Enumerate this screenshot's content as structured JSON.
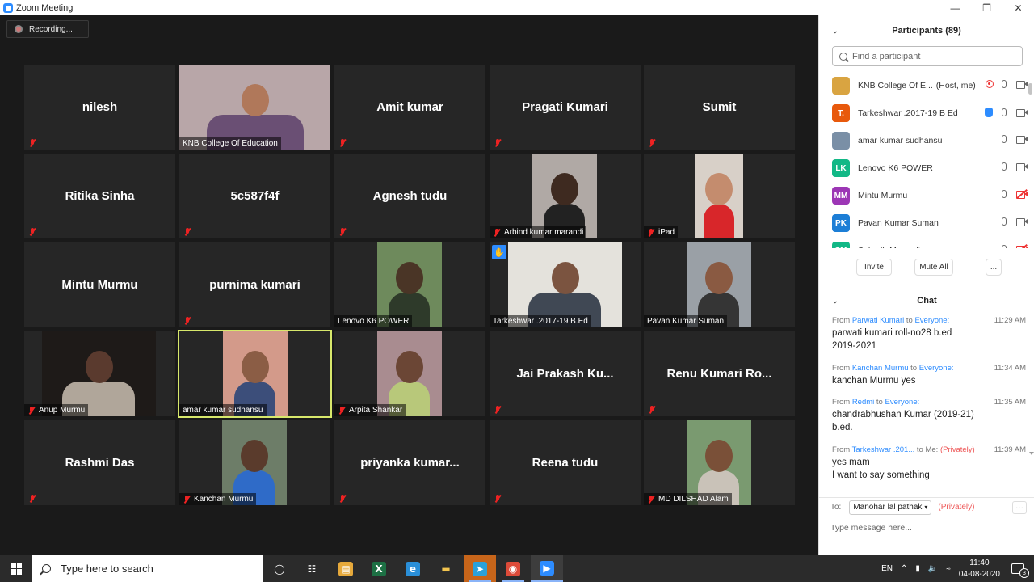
{
  "window": {
    "title": "Zoom Meeting",
    "controls": [
      "—",
      "❐",
      "✕"
    ]
  },
  "recording": {
    "label": "Recording..."
  },
  "tiles": [
    {
      "name": "nilesh",
      "video": false,
      "muted": true
    },
    {
      "name": "KNB College Of Education",
      "video": true,
      "muted": false
    },
    {
      "name": "Amit kumar",
      "video": false,
      "muted": true
    },
    {
      "name": "Pragati Kumari",
      "video": false,
      "muted": true
    },
    {
      "name": "Sumit",
      "video": false,
      "muted": true
    },
    {
      "name": "Ritika Sinha",
      "video": false,
      "muted": true
    },
    {
      "name": "5c587f4f",
      "video": false,
      "muted": true
    },
    {
      "name": "Agnesh tudu",
      "video": false,
      "muted": true
    },
    {
      "name": "Arbind kumar marandi",
      "video": true,
      "muted": true
    },
    {
      "name": "iPad",
      "video": true,
      "muted": true
    },
    {
      "name": "Mintu Murmu",
      "video": false,
      "muted": false
    },
    {
      "name": "purnima kumari",
      "video": false,
      "muted": true
    },
    {
      "name": "Lenovo K6 POWER",
      "video": true,
      "muted": false
    },
    {
      "name": "Tarkeshwar .2017-19 B.Ed",
      "video": true,
      "muted": false,
      "hand": true
    },
    {
      "name": "Pavan Kumar Suman",
      "video": true,
      "muted": false
    },
    {
      "name": "Anup Murmu",
      "video": true,
      "muted": true
    },
    {
      "name": "amar kumar sudhansu",
      "video": true,
      "muted": false,
      "active": true
    },
    {
      "name": "Arpita Shankar",
      "video": true,
      "muted": true
    },
    {
      "name": "Jai Prakash Ku...",
      "video": false,
      "muted": true
    },
    {
      "name": "Renu Kumari Ro...",
      "video": false,
      "muted": true
    },
    {
      "name": "Rashmi Das",
      "video": false,
      "muted": true
    },
    {
      "name": "Kanchan Murmu",
      "video": true,
      "muted": true
    },
    {
      "name": "priyanka kumar...",
      "video": false,
      "muted": true
    },
    {
      "name": "Reena tudu",
      "video": false,
      "muted": true
    },
    {
      "name": "MD DILSHAD Alam",
      "video": true,
      "muted": true
    }
  ],
  "participants": {
    "header": "Participants (89)",
    "search_placeholder": "Find a participant",
    "list": [
      {
        "initials": "",
        "name": "KNB College Of E...",
        "host": "(Host, me)",
        "avatar_color": "#d9a441",
        "recording": true,
        "hand": false,
        "cam_off": false
      },
      {
        "initials": "T.",
        "name": "Tarkeshwar .2017-19 B Ed",
        "host": "",
        "avatar_color": "#e8590c",
        "recording": false,
        "hand": true,
        "cam_off": false
      },
      {
        "initials": "",
        "name": "amar kumar sudhansu",
        "host": "",
        "avatar_color": "#7a8fa6",
        "recording": false,
        "hand": false,
        "cam_off": false
      },
      {
        "initials": "LK",
        "name": "Lenovo K6 POWER",
        "host": "",
        "avatar_color": "#12b886",
        "recording": false,
        "hand": false,
        "cam_off": false
      },
      {
        "initials": "MM",
        "name": "Mintu Murmu",
        "host": "",
        "avatar_color": "#9c36b5",
        "recording": false,
        "hand": false,
        "cam_off": true
      },
      {
        "initials": "PK",
        "name": "Pavan Kumar Suman",
        "host": "",
        "avatar_color": "#1c7ed6",
        "recording": false,
        "hand": false,
        "cam_off": false
      },
      {
        "initials": "SM",
        "name": "Subodh Marandi",
        "host": "",
        "avatar_color": "#12b886",
        "recording": false,
        "hand": false,
        "cam_off": true
      }
    ],
    "invite_label": "Invite",
    "mute_all_label": "Mute All",
    "more_label": "..."
  },
  "chat": {
    "header": "Chat",
    "messages": [
      {
        "from_word": "From",
        "sender": "Parwati Kumari",
        "to_word": "to",
        "recipient": "Everyone:",
        "private": "",
        "time": "11:29 AM",
        "lines": [
          "parwati kumari roll-no28 b.ed",
          "2019-2021"
        ]
      },
      {
        "from_word": "From",
        "sender": "Kanchan Murmu",
        "to_word": "to",
        "recipient": "Everyone:",
        "private": "",
        "time": "11:34 AM",
        "lines": [
          "kanchan Murmu yes"
        ]
      },
      {
        "from_word": "From",
        "sender": "Redmi",
        "to_word": "to",
        "recipient": "Everyone:",
        "private": "",
        "time": "11:35 AM",
        "lines": [
          "chandrabhushan Kumar (2019-21)",
          "b.ed."
        ]
      },
      {
        "from_word": "From",
        "sender": "Tarkeshwar .201...",
        "to_word": "to Me:",
        "recipient": "",
        "private": "(Privately)",
        "time": "11:39 AM",
        "lines": [
          "yes mam",
          "I want to say something"
        ]
      }
    ],
    "to_label": "To:",
    "to_value": "Manohar lal pathak",
    "to_private": "(Privately)",
    "more_label": "···",
    "input_placeholder": "Type message here..."
  },
  "taskbar": {
    "search_placeholder": "Type here to search",
    "apps": [
      "cortana-icon",
      "task-view-icon",
      "store-icon",
      "excel-icon",
      "edge-icon",
      "file-explorer-icon",
      "telegram-icon",
      "chrome-icon",
      "zoom-icon"
    ],
    "language": "EN",
    "time": "11:40",
    "date": "04-08-2020",
    "notification_count": "3"
  }
}
